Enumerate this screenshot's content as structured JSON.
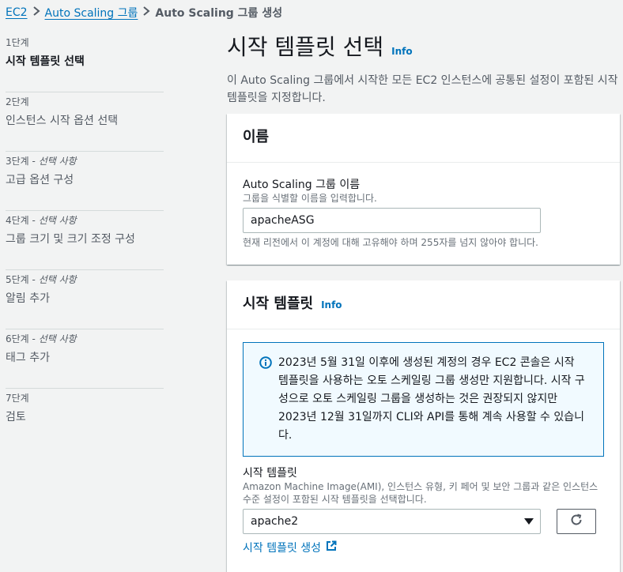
{
  "breadcrumb": {
    "items": [
      "EC2",
      "Auto Scaling 그룹"
    ],
    "current": "Auto Scaling 그룹 생성"
  },
  "sidebar": {
    "steps": [
      {
        "num": "1단계",
        "optional": "",
        "title": "시작 템플릿 선택"
      },
      {
        "num": "2단계",
        "optional": "",
        "title": "인스턴스 시작 옵션 선택"
      },
      {
        "num": "3단계",
        "optional": "선택 사항",
        "title": "고급 옵션 구성"
      },
      {
        "num": "4단계",
        "optional": "선택 사항",
        "title": "그룹 크기 및 크기 조정 구성"
      },
      {
        "num": "5단계",
        "optional": "선택 사항",
        "title": "알림 추가"
      },
      {
        "num": "6단계",
        "optional": "선택 사항",
        "title": "태그 추가"
      },
      {
        "num": "7단계",
        "optional": "",
        "title": "검토"
      }
    ]
  },
  "main": {
    "title": "시작 템플릿 선택",
    "info": "Info",
    "description": "이 Auto Scaling 그룹에서 시작한 모든 EC2 인스턴스에 공통된 설정이 포함된 시작 템플릿을 지정합니다."
  },
  "name_card": {
    "header": "이름",
    "label": "Auto Scaling 그룹 이름",
    "desc": "그룹을 식별할 이름을 입력합니다.",
    "value": "apacheASG",
    "constraint": "현재 리전에서 이 계정에 대해 고유해야 하며 255자를 넘지 않아야 합니다."
  },
  "template_card": {
    "header": "시작 템플릿",
    "info": "Info",
    "alert": "2023년 5월 31일 이후에 생성된 계정의 경우 EC2 콘솔은 시작 템플릿을 사용하는 오토 스케일링 그룹 생성만 지원합니다. 시작 구성으로 오토 스케일링 그룹을 생성하는 것은 권장되지 않지만 2023년 12월 31일까지 CLI와 API를 통해 계속 사용할 수 있습니다.",
    "label": "시작 템플릿",
    "desc": "Amazon Machine Image(AMI), 인스턴스 유형, 키 페어 및 보안 그룹과 같은 인스턴스 수준 설정이 포함된 시작 템플릿을 선택합니다.",
    "selected": "apache2",
    "create_link": "시작 템플릿 생성"
  },
  "colors": {
    "link": "#0073bb",
    "alert_border": "#0073bb",
    "alert_bg": "#f1faff"
  }
}
